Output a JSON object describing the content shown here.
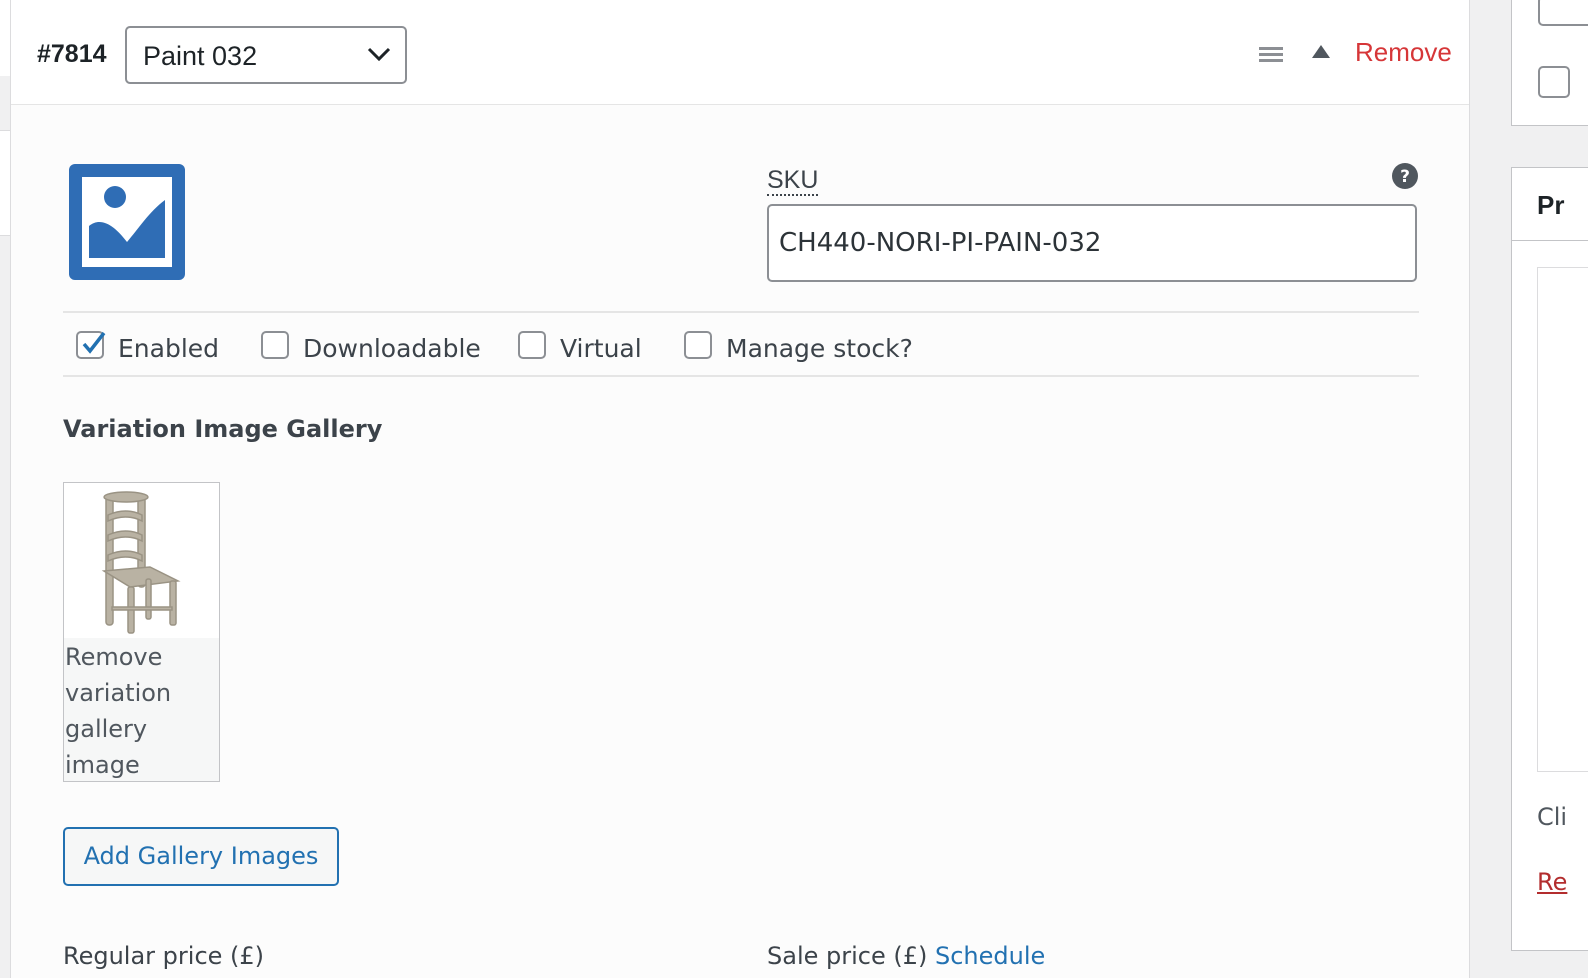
{
  "variation": {
    "id": "#7814",
    "selected_option": "Paint 032",
    "remove_label": "Remove",
    "icons": [
      "menu-icon",
      "arrow-up-icon",
      "image-placeholder-icon",
      "help-icon"
    ]
  },
  "sku": {
    "label": "SKU",
    "value": "CH440-NORI-PI-PAIN-032"
  },
  "options": [
    {
      "label": "Enabled",
      "checked": true
    },
    {
      "label": "Downloadable",
      "checked": false
    },
    {
      "label": "Virtual",
      "checked": false
    },
    {
      "label": "Manage stock?",
      "checked": false
    }
  ],
  "gallery": {
    "title": "Variation Image Gallery",
    "item_remove_label": "Remove variation gallery image",
    "add_button_label": "Add Gallery Images"
  },
  "pricing": {
    "regular_label": "Regular price (£)",
    "sale_label": "Sale price (£)",
    "schedule_label": "Schedule"
  },
  "sidebar": {
    "box_title": "Pr",
    "text": "Cli",
    "link": "Re"
  },
  "colors": {
    "accent": "#2271b1",
    "danger": "#d63638",
    "border": "#8c8f94"
  }
}
